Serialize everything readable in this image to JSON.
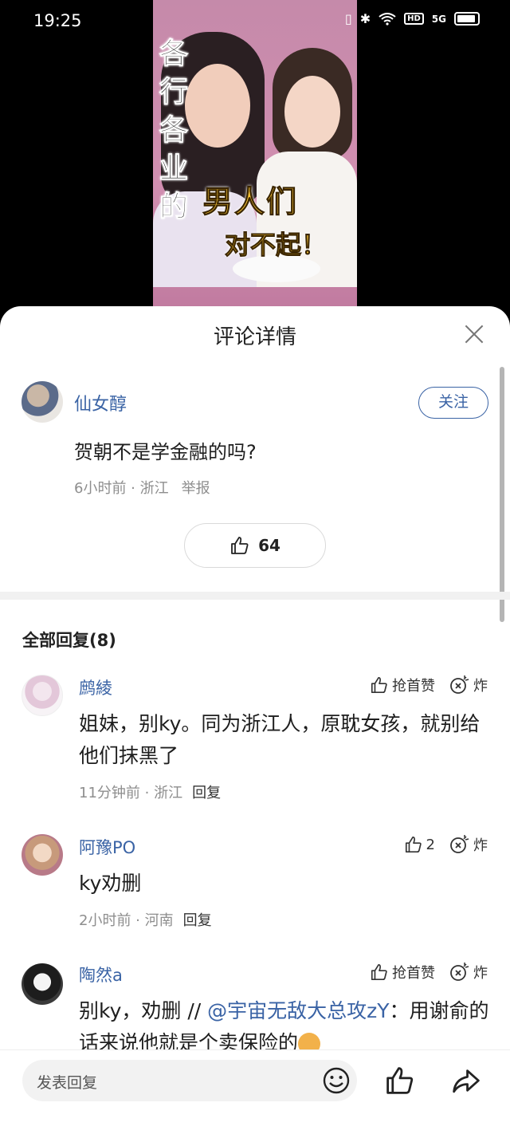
{
  "status_bar": {
    "time": "19:25",
    "hd": "HD",
    "signal": "5G"
  },
  "video": {
    "vertical_chars": [
      "各",
      "行",
      "各",
      "业",
      "的"
    ],
    "main_line": "男人们",
    "sub_line": "对不起！"
  },
  "panel": {
    "title": "评论详情",
    "scrollbar_color": "#b5b5b5"
  },
  "main_comment": {
    "user": "仙女醇",
    "follow_label": "关注",
    "text": "贺朝不是学金融的吗?",
    "time_loc": "6小时前 · 浙江",
    "report": "举报",
    "likes": "64"
  },
  "replies_header": "全部回复(8)",
  "replies": [
    {
      "user": "鹧綾",
      "like_label": "抢首赞",
      "bomb_label": "炸",
      "text": "姐妹，别ky。同为浙江人，原耽女孩，就别给他们抹黑了",
      "time_loc": "11分钟前 · 浙江",
      "reply_label": "回复"
    },
    {
      "user": "阿豫PO",
      "like_label": "2",
      "bomb_label": "炸",
      "text": "ky劝删",
      "time_loc": "2小时前 · 河南",
      "reply_label": "回复"
    },
    {
      "user": "陶然a",
      "like_label": "抢首赞",
      "bomb_label": "炸",
      "text_prefix": "别ky，劝删 // ",
      "mention": "@宇宙无敌大总攻zY",
      "text_suffix": "：用谢俞的话来说他就是个卖保险的"
    }
  ],
  "bottom_bar": {
    "input_placeholder": "发表回复"
  },
  "colors": {
    "link": "#3a63a5",
    "meta": "#8e8e8e",
    "text": "#1e1e1e"
  }
}
